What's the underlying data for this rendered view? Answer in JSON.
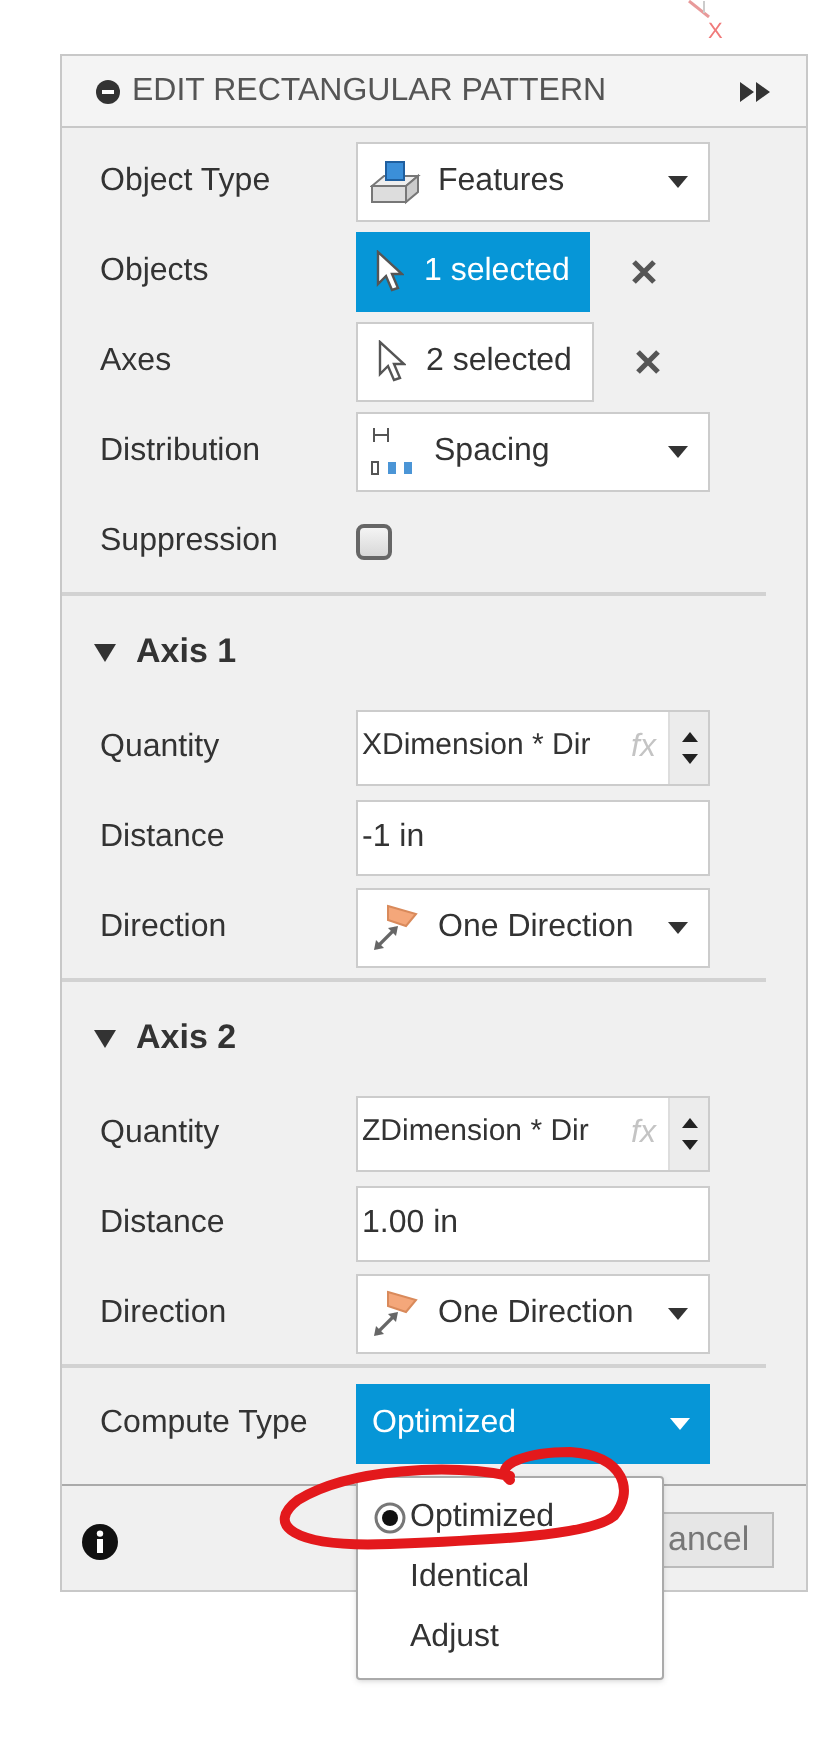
{
  "canvas": {
    "axis_label": "X"
  },
  "panel": {
    "title": "EDIT RECTANGULAR PATTERN"
  },
  "rows": [
    {
      "kind": "dropdown",
      "label": "Object Type",
      "value": "Features"
    },
    {
      "kind": "selection",
      "label": "Objects",
      "value": "1 selected",
      "selected": true
    },
    {
      "kind": "selection",
      "label": "Axes",
      "value": "2 selected",
      "selected": false
    },
    {
      "kind": "dropdown",
      "label": "Distribution",
      "value": "Spacing"
    },
    {
      "kind": "checkbox",
      "label": "Suppression",
      "checked": false
    }
  ],
  "axes": [
    {
      "title": "Axis 1",
      "expanded": true,
      "quantity": {
        "label": "Quantity",
        "value": "XDimension * Dir",
        "fx": "fx"
      },
      "distance": {
        "label": "Distance",
        "value": "-1 in"
      },
      "direction": {
        "label": "Direction",
        "value": "One Direction"
      }
    },
    {
      "title": "Axis 2",
      "expanded": true,
      "quantity": {
        "label": "Quantity",
        "value": "ZDimension * Dir",
        "fx": "fx"
      },
      "distance": {
        "label": "Distance",
        "value": "1.00 in"
      },
      "direction": {
        "label": "Direction",
        "value": "One Direction"
      }
    }
  ],
  "compute_type": {
    "label": "Compute Type",
    "value": "Optimized",
    "open": true,
    "options": [
      {
        "label": "Optimized",
        "selected": true
      },
      {
        "label": "Identical",
        "selected": false
      },
      {
        "label": "Adjust",
        "selected": false
      }
    ]
  },
  "footer": {
    "cancel_button": "ancel"
  }
}
